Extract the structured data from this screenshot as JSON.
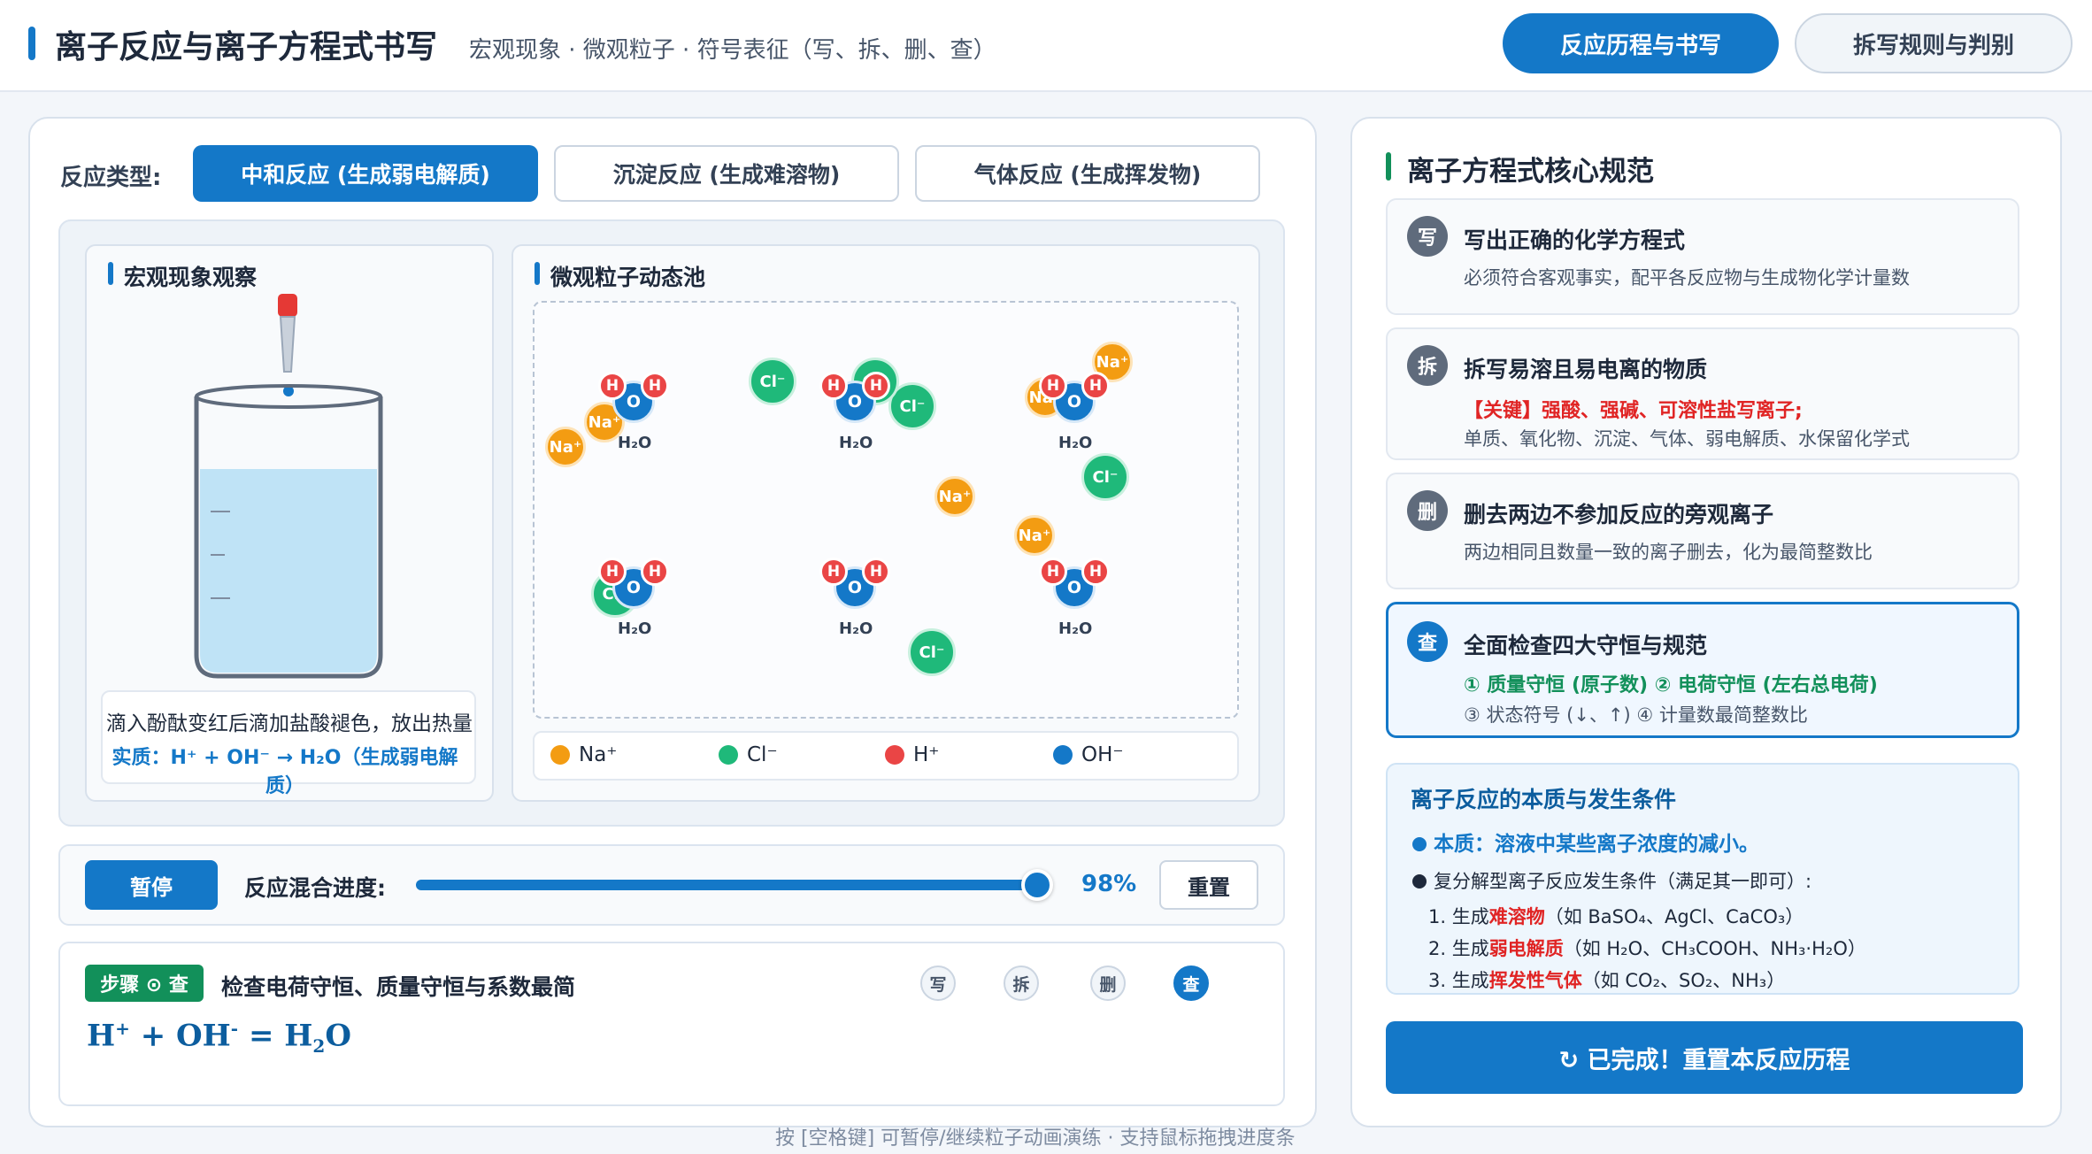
{
  "header": {
    "title": "离子反应与离子方程式书写",
    "subtitle": "宏观现象 · 微观粒子 · 符号表征（写、拆、删、查）",
    "tabs": [
      {
        "label": "反应历程与书写",
        "active": true
      },
      {
        "label": "拆写规则与判别",
        "active": false
      }
    ]
  },
  "reaction_type": {
    "label": "反应类型:",
    "options": [
      {
        "label": "中和反应 (生成弱电解质)",
        "active": true
      },
      {
        "label": "沉淀反应 (生成难溶物)",
        "active": false
      },
      {
        "label": "气体反应 (生成挥发物)",
        "active": false
      }
    ]
  },
  "macro": {
    "title": "宏观现象观察",
    "caption": "滴入酚酞变红后滴加盐酸褪色，放出热量",
    "essence": "实质：H⁺ + OH⁻ → H₂O（生成弱电解质）"
  },
  "micro": {
    "title": "微观粒子动态池",
    "ion_labels": {
      "na": "Na⁺",
      "cl": "Cl⁻",
      "h": "H",
      "o": "O",
      "water": "H₂O"
    },
    "legend": [
      {
        "label": "Na⁺",
        "color": "#f39c12"
      },
      {
        "label": "Cl⁻",
        "color": "#1fb97a"
      },
      {
        "label": "H⁺",
        "color": "#ea4545"
      },
      {
        "label": "OH⁻",
        "color": "#1478c8"
      }
    ]
  },
  "progress": {
    "pause_label": "暂停",
    "label": "反应混合进度:",
    "value": 98,
    "value_text": "98%",
    "reset_label": "重置"
  },
  "step": {
    "badge": "步骤 ⊙ 查",
    "title": "检查电荷守恒、质量守恒与系数最简",
    "dots": [
      "写",
      "拆",
      "删",
      "查"
    ],
    "active_index": 3,
    "equation": {
      "lhs1": "H",
      "lhs1_sup": "+",
      "plus": " + OH",
      "lhs2_sup": "-",
      "eq": " = H",
      "sub": "2",
      "tail": "O"
    }
  },
  "footer_hint": "按 [空格键] 可暂停/继续粒子动画演练 · 支持鼠标拖拽进度条",
  "rules_panel": {
    "title": "离子方程式核心规范",
    "rules": [
      {
        "icon": "写",
        "heading": "写出正确的化学方程式",
        "text": "必须符合客观事实，配平各反应物与生成物化学计量数"
      },
      {
        "icon": "拆",
        "heading": "拆写易溶且易电离的物质",
        "key": "【关键】强酸、强碱、可溶性盐写离子;",
        "text": "单质、氧化物、沉淀、气体、弱电解质、水保留化学式"
      },
      {
        "icon": "删",
        "heading": "删去两边不参加反应的旁观离子",
        "text": "两边相同且数量一致的离子删去，化为最简整数比"
      },
      {
        "icon": "查",
        "heading": "全面检查四大守恒与规范",
        "key": "① 质量守恒 (原子数) ② 电荷守恒 (左右总电荷)",
        "text": "③ 状态符号 (↓、↑) ④ 计量数最简整数比"
      }
    ]
  },
  "essence_panel": {
    "title": "离子反应的本质与发生条件",
    "line1": "本质：溶液中某些离子浓度的减小。",
    "line2": "复分解型离子反应发生条件（满足其一即可）:",
    "items": [
      {
        "prefix": "1. 生成",
        "hl": "难溶物",
        "rest": "（如 BaSO₄、AgCl、CaCO₃）"
      },
      {
        "prefix": "2. 生成",
        "hl": "弱电解质",
        "rest": "（如 H₂O、CH₃COOH、NH₃·H₂O）"
      },
      {
        "prefix": "3. 生成",
        "hl": "挥发性气体",
        "rest": "（如 CO₂、SO₂、NH₃）"
      }
    ]
  },
  "done_button": "↻ 已完成！重置本反应历程"
}
